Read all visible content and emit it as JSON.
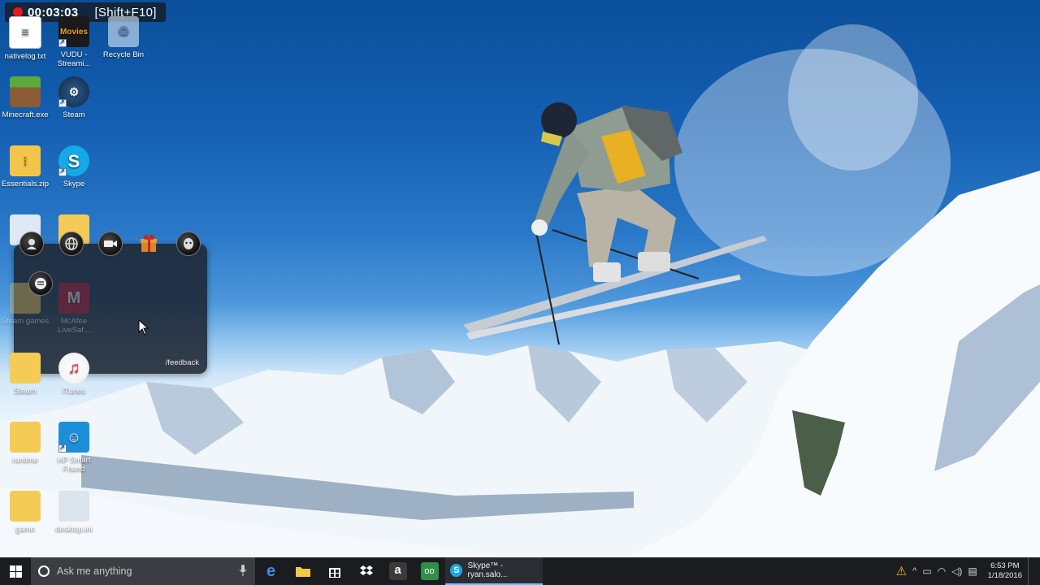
{
  "recording": {
    "time": "00:03:03",
    "shortcut": "[Shift+F10]"
  },
  "desktop_icons": [
    {
      "label": "nativelog.txt"
    },
    {
      "label": "VUDU - Streami..."
    },
    {
      "label": "Recycle Bin"
    },
    {
      "label": "Minecraft.exe"
    },
    {
      "label": "Steam"
    },
    {
      "label": "Essentials.zip"
    },
    {
      "label": "Skype"
    },
    {
      "label": "Steam games"
    },
    {
      "label": "McAfee LiveSaf..."
    },
    {
      "label": "Steam"
    },
    {
      "label": "iTunes"
    },
    {
      "label": "runtime"
    },
    {
      "label": "HP Smart Friend"
    },
    {
      "label": "game"
    },
    {
      "label": "desktop.ini"
    }
  ],
  "vudu_badge": "Movies",
  "overlay": {
    "feedback": "/feedback"
  },
  "taskbar": {
    "search_placeholder": "Ask me anything",
    "skype_window_title": "Skype™ - ryan.salo...",
    "time": "6:53 PM",
    "date": "1/18/2016"
  }
}
